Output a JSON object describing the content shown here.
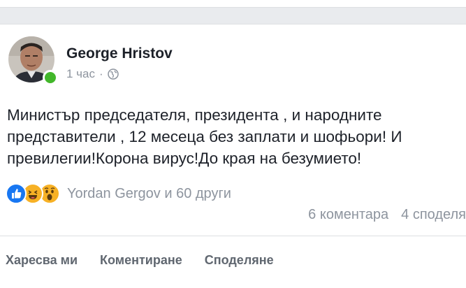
{
  "post": {
    "author": "George Hristov",
    "time": "1 час",
    "separator": "·",
    "privacy_icon": "globe-icon",
    "text": "Министър председателя, президента , и народните представители , 12 месеца без заплати и шофьори! И превилегии!Корона вирус!До края на безумието!",
    "reactions": {
      "icons": [
        "like-icon",
        "haha-icon",
        "wow-icon"
      ],
      "label": "Yordan Gergov и 60 други"
    },
    "comments_count": "6 коментара",
    "shares_count": "4 споделя",
    "actions": {
      "like": "Харесва ми",
      "comment": "Коментиране",
      "share": "Споделяне"
    },
    "colors": {
      "like_blue": "#1877f2",
      "reaction_yellow": "#f7b125",
      "online_green": "#42b72a",
      "meta_gray": "#8d949e"
    }
  }
}
